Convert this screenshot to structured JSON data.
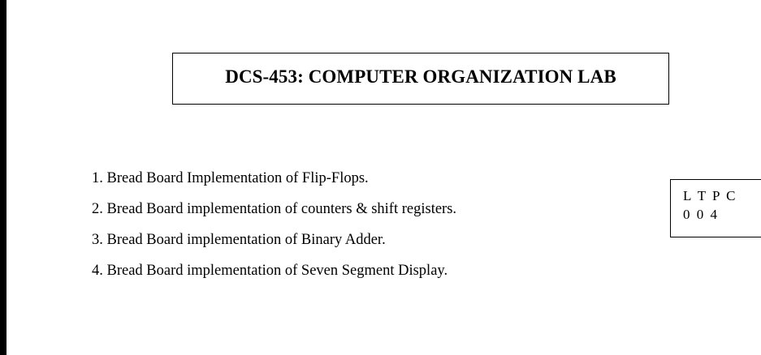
{
  "course": {
    "title": "DCS-453: COMPUTER ORGANIZATION LAB"
  },
  "experiments": [
    "1. Bread Board Implementation of Flip-Flops.",
    "2. Bread Board implementation of counters & shift registers.",
    "3. Bread Board implementation of Binary Adder.",
    "4. Bread Board implementation of Seven Segment Display."
  ],
  "credits": {
    "header": "L T P C",
    "values": "0 0 4"
  }
}
